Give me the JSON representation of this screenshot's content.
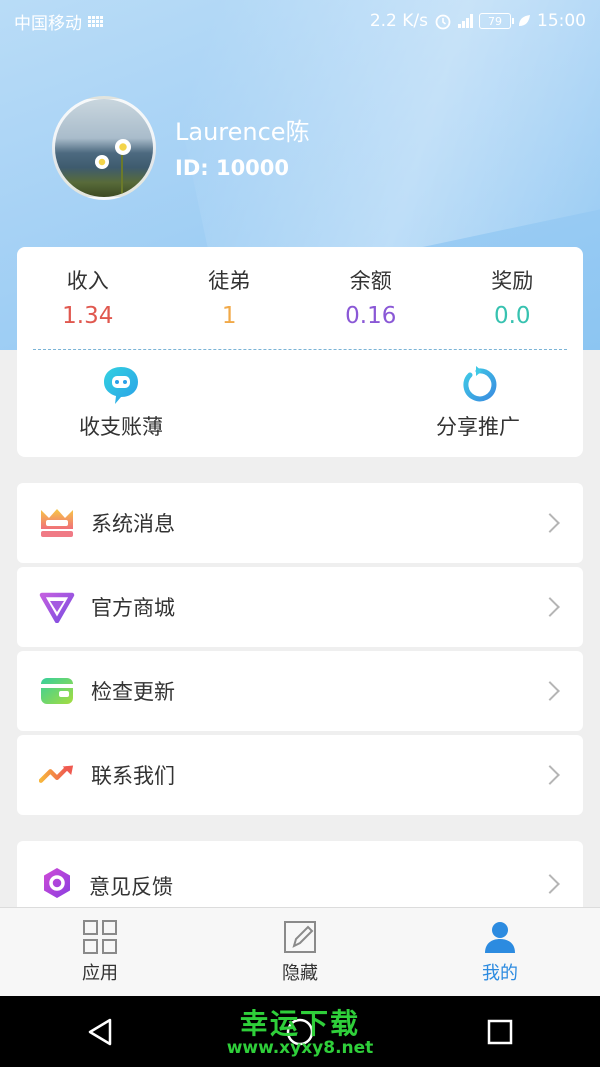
{
  "status_bar": {
    "carrier": "中国移动",
    "speed": "2.2 K/s",
    "battery": "79",
    "time": "15:00"
  },
  "profile": {
    "name": "Laurence陈",
    "id": "ID: 10000"
  },
  "stats": [
    {
      "label": "收入",
      "value": "1.34",
      "color": "#e0584f"
    },
    {
      "label": "徒弟",
      "value": "1",
      "color": "#f1a948"
    },
    {
      "label": "余额",
      "value": "0.16",
      "color": "#8a58d6"
    },
    {
      "label": "奖励",
      "value": "0.0",
      "color": "#37c2b0"
    }
  ],
  "actions": {
    "ledger": "收支账薄",
    "share": "分享推广"
  },
  "menu": [
    {
      "label": "系统消息",
      "icon": "crown-icon"
    },
    {
      "label": "官方商城",
      "icon": "diamond-icon"
    },
    {
      "label": "检查更新",
      "icon": "wallet-icon"
    },
    {
      "label": "联系我们",
      "icon": "trend-icon"
    },
    {
      "label": "意见反馈",
      "icon": "hexagon-icon"
    }
  ],
  "tabs": [
    {
      "label": "应用",
      "icon": "grid-icon"
    },
    {
      "label": "隐藏",
      "icon": "edit-icon"
    },
    {
      "label": "我的",
      "icon": "user-icon",
      "active": true
    }
  ],
  "watermark": {
    "title": "幸运下载",
    "url": "www.xyxy8.net"
  },
  "colors": {
    "accent": "#2c8be0",
    "header": "#a7d2f5"
  }
}
